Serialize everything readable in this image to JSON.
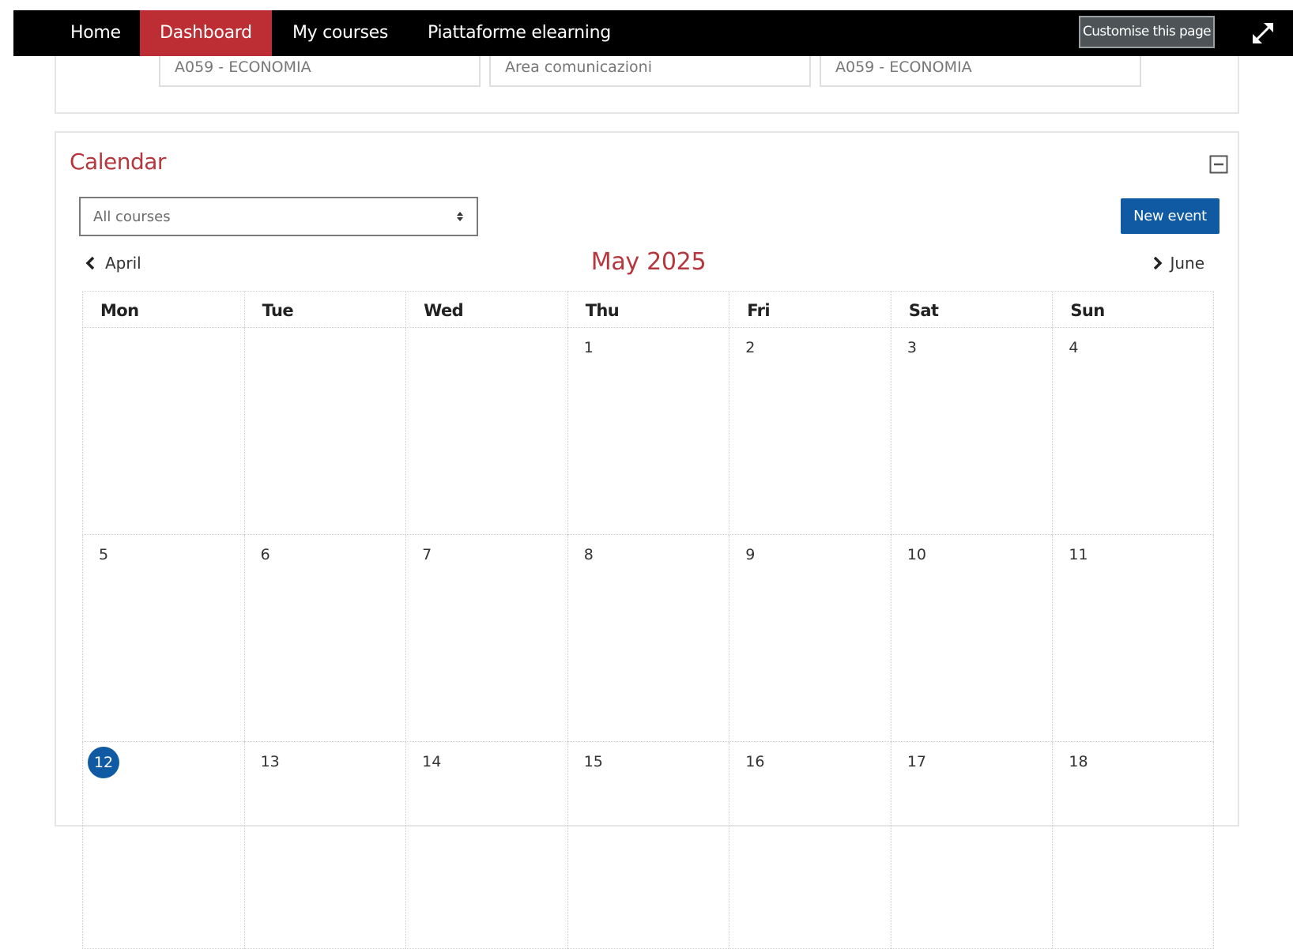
{
  "navbar": {
    "items": [
      {
        "label": "Home"
      },
      {
        "label": "Dashboard",
        "active": true
      },
      {
        "label": "My courses"
      },
      {
        "label": "Piattaforme elearning"
      }
    ],
    "customise_label": "Customise this page"
  },
  "courses_block": {
    "cards": [
      {
        "name": "A059 - ECONOMIA"
      },
      {
        "name": "Area comunicazioni"
      },
      {
        "name": "A059 - ECONOMIA"
      }
    ]
  },
  "calendar": {
    "title": "Calendar",
    "course_filter": "All courses",
    "new_event_label": "New event",
    "prev_month": "April",
    "next_month": "June",
    "current_month": "May 2025",
    "weekdays": [
      "Mon",
      "Tue",
      "Wed",
      "Thu",
      "Fri",
      "Sat",
      "Sun"
    ],
    "weeks": [
      [
        "",
        "",
        "",
        "1",
        "2",
        "3",
        "4"
      ],
      [
        "5",
        "6",
        "7",
        "8",
        "9",
        "10",
        "11"
      ],
      [
        "12",
        "13",
        "14",
        "15",
        "16",
        "17",
        "18"
      ]
    ],
    "today": "12"
  },
  "colors": {
    "navbar_bg": "#000000",
    "active_tab": "#bd2d34",
    "accent_red": "#b5373d",
    "primary_blue": "#0f5aa3"
  }
}
